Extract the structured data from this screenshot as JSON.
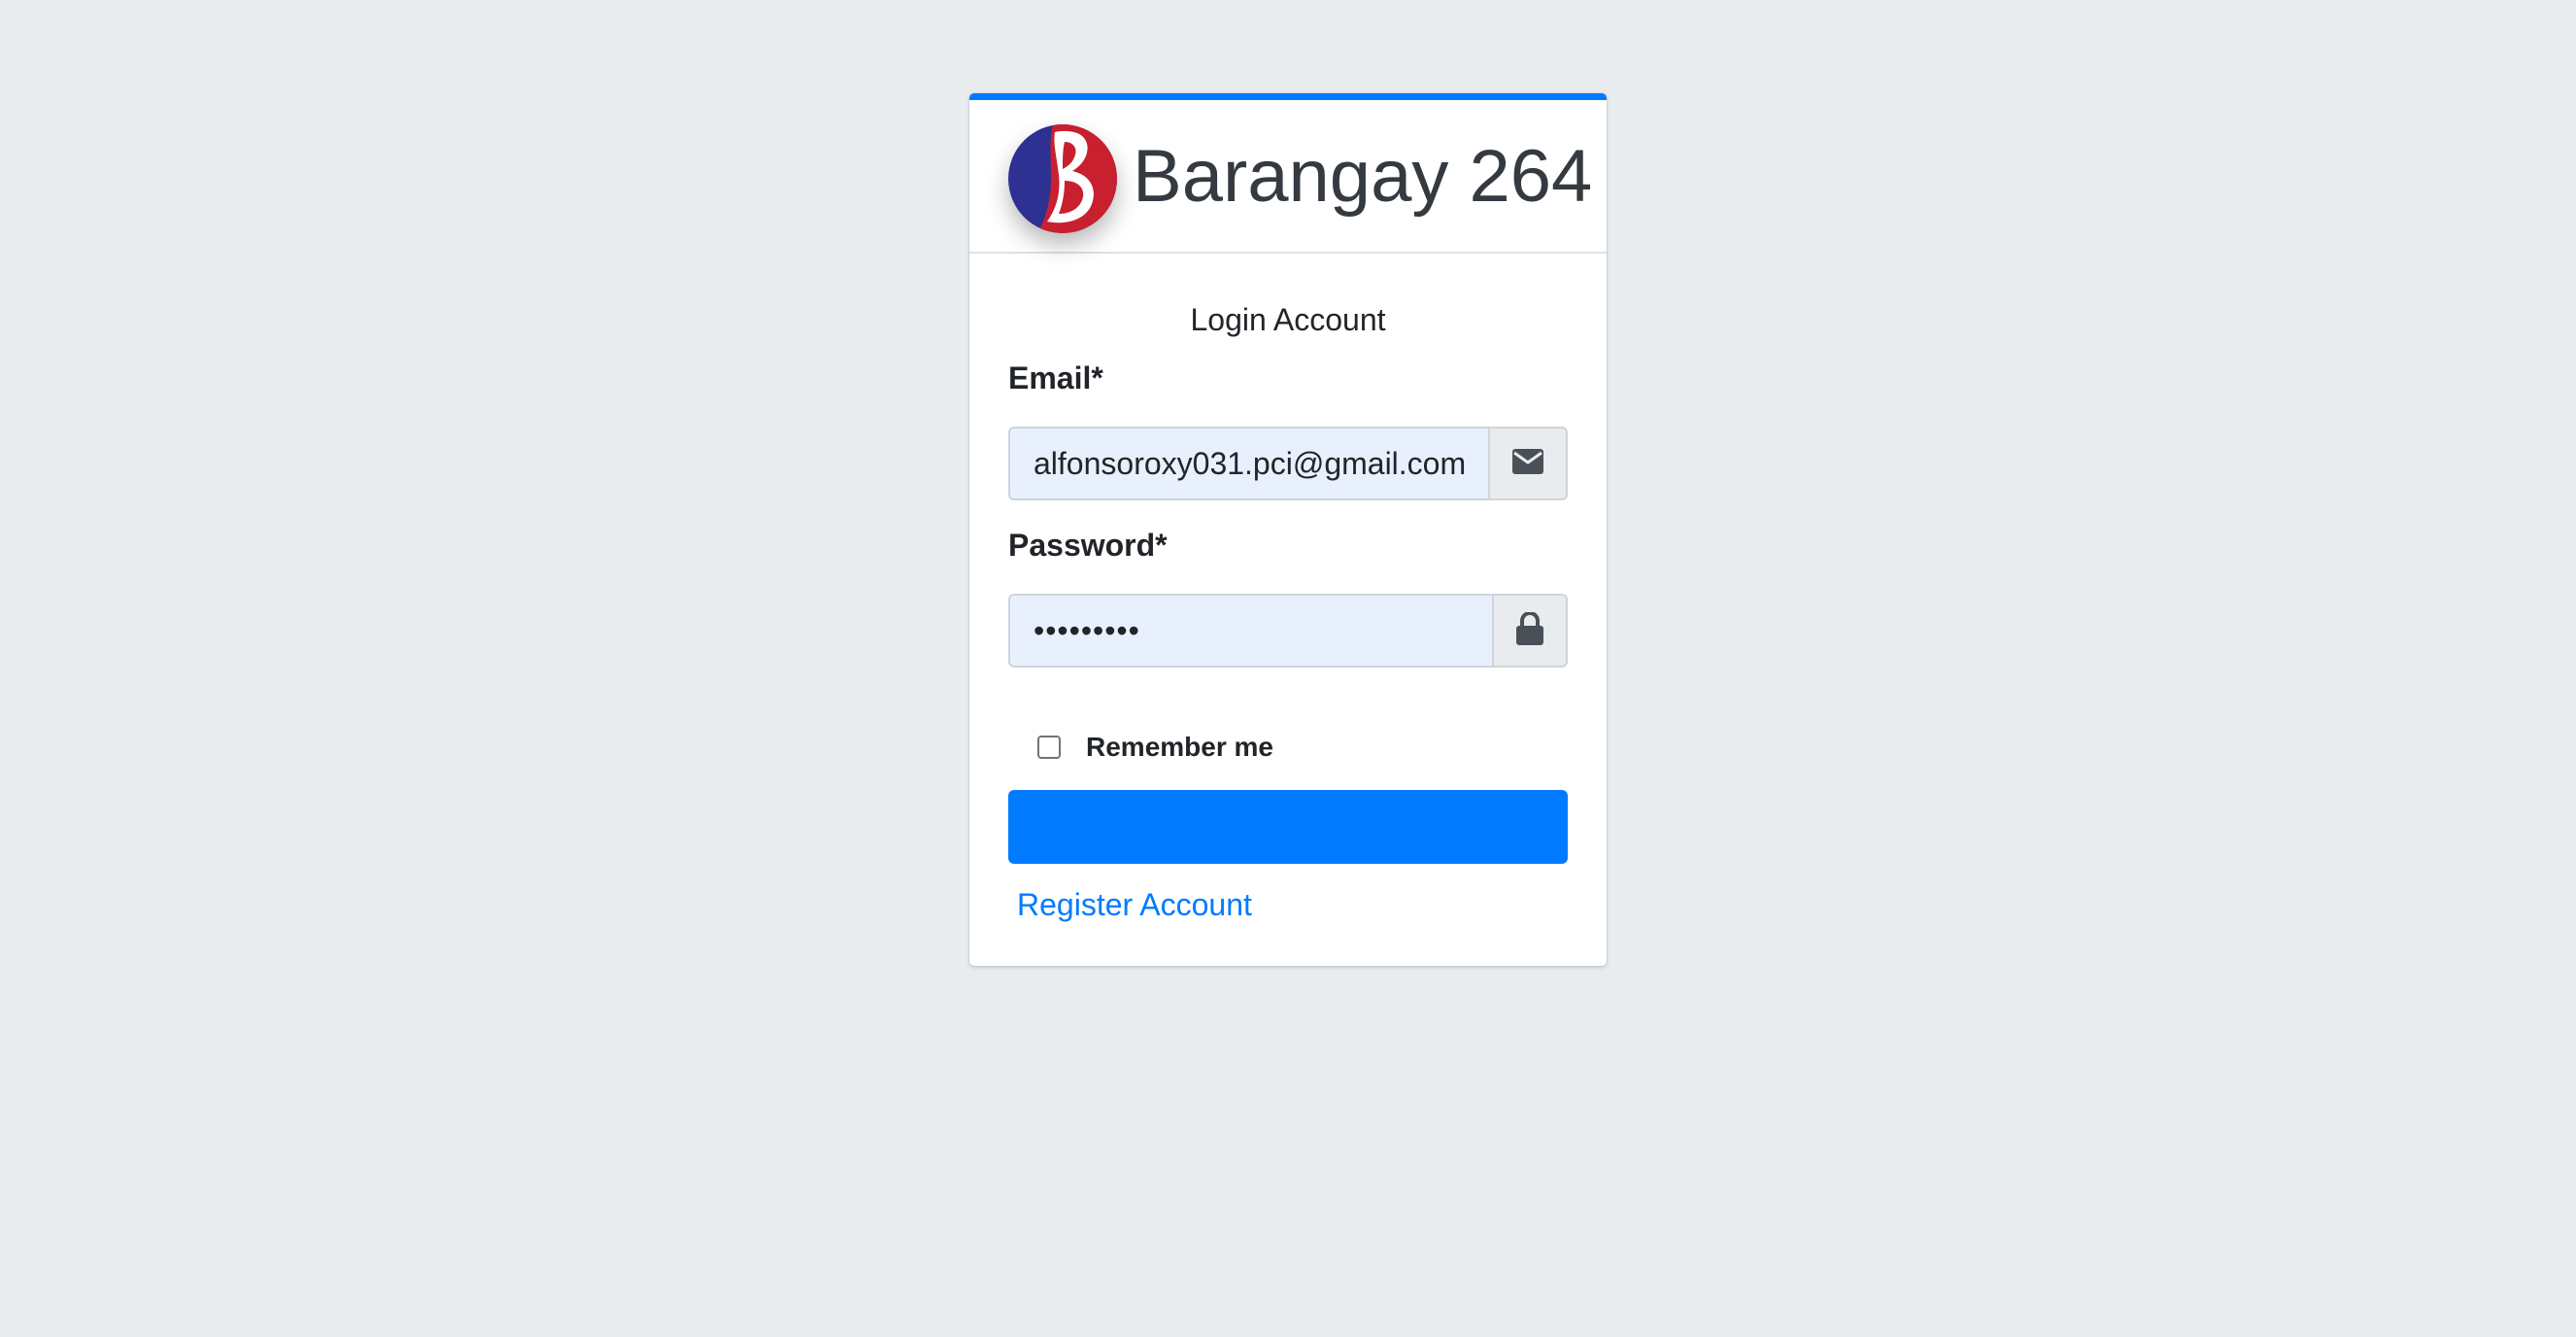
{
  "brand": {
    "name": "Barangay 264",
    "logo_icon": "barangay-b-logo"
  },
  "login": {
    "message": "Login Account",
    "email": {
      "label": "Email*",
      "value": "alfonsoroxy031.pci@gmail.com",
      "icon": "envelope-icon"
    },
    "password": {
      "label": "Password*",
      "value": "•••••••••",
      "icon": "lock-icon"
    },
    "remember_label": "Remember me",
    "remember_checked": false,
    "submit_label": "",
    "register_label": "Register Account"
  },
  "colors": {
    "background": "#e9ecef",
    "primary": "#007bff",
    "autofill": "#e8f0fe",
    "logo_blue": "#2e3192",
    "logo_red": "#c8202f"
  }
}
